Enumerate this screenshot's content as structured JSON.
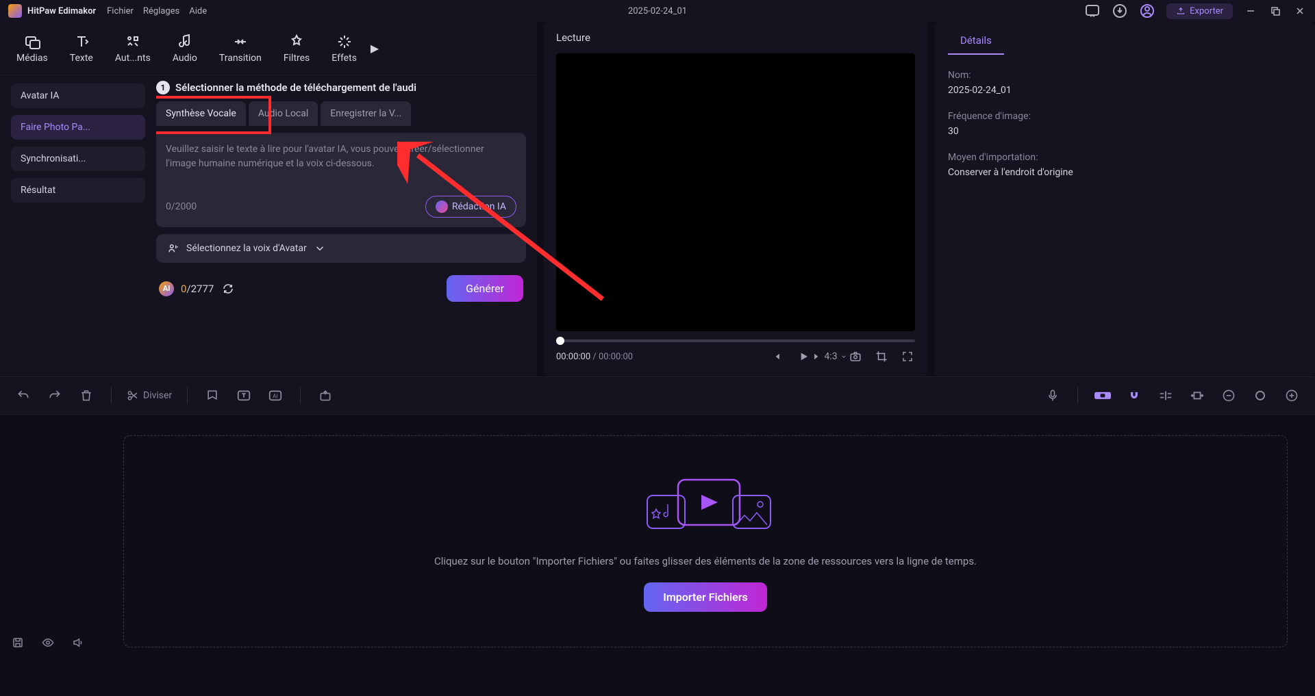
{
  "app": {
    "name": "HitPaw Edimakor",
    "menus": [
      "Fichier",
      "Réglages",
      "Aide"
    ],
    "project_title": "2025-02-24_01",
    "export_label": "Exporter"
  },
  "ribbon": {
    "tabs": [
      {
        "id": "media",
        "label": "Médias"
      },
      {
        "id": "text",
        "label": "Texte"
      },
      {
        "id": "auto",
        "label": "Aut...nts"
      },
      {
        "id": "audio",
        "label": "Audio"
      },
      {
        "id": "transition",
        "label": "Transition"
      },
      {
        "id": "filters",
        "label": "Filtres"
      },
      {
        "id": "effects",
        "label": "Effets"
      }
    ]
  },
  "sidebar": {
    "items": [
      {
        "id": "avatar",
        "label": "Avatar IA",
        "active": false
      },
      {
        "id": "photo",
        "label": "Faire Photo Pa...",
        "active": true
      },
      {
        "id": "sync",
        "label": "Synchronisati...",
        "active": false
      },
      {
        "id": "result",
        "label": "Résultat",
        "active": false
      }
    ]
  },
  "step": {
    "number": "1",
    "heading": "Sélectionner la méthode de téléchargement de l'audi"
  },
  "audio_tabs": [
    {
      "id": "tts",
      "label": "Synthèse Vocale",
      "active": true
    },
    {
      "id": "local",
      "label": "Audio Local",
      "active": false
    },
    {
      "id": "record",
      "label": "Enregistrer la V...",
      "active": false
    }
  ],
  "tts": {
    "placeholder": "Veuillez saisir le texte à lire pour l'avatar IA, vous pouvez créer/sélectionner l'image humaine numérique et la voix ci-dessous.",
    "count": "0",
    "max": "/2000",
    "ai_button": "Rédaction IA",
    "voice_select": "Sélectionnez la voix d'Avatar"
  },
  "credits": {
    "zero": "0",
    "total": "/2777",
    "generate": "Générer"
  },
  "preview": {
    "title": "Lecture",
    "time_current": "00:00:00",
    "time_total": " / 00:00:00",
    "ratio": "4:3"
  },
  "details": {
    "tab": "Détails",
    "name_label": "Nom:",
    "name_value": "2025-02-24_01",
    "fps_label": "Fréquence d'image:",
    "fps_value": "30",
    "import_label": "Moyen d'importation:",
    "import_value": "Conserver à l'endroit d'origine"
  },
  "toolbar": {
    "split": "Diviser"
  },
  "timeline": {
    "drop_text": "Cliquez sur le bouton \"Importer Fichiers\" ou faites glisser des éléments de la zone de ressources vers la ligne de temps.",
    "import_button": "Importer Fichiers"
  }
}
